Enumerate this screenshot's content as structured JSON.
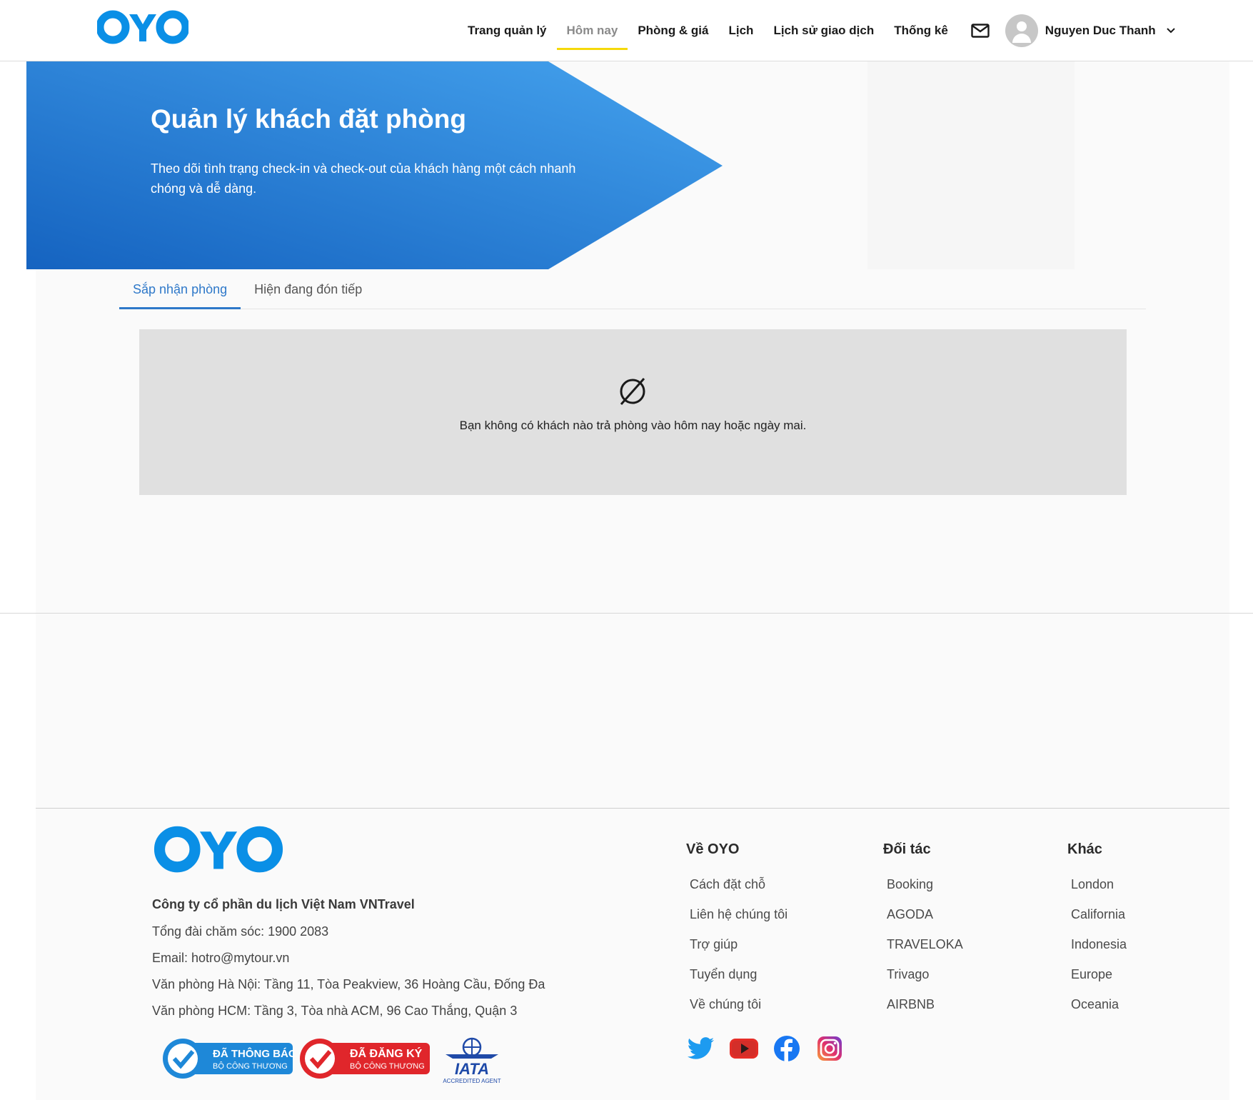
{
  "header": {
    "logo_text": "OYO",
    "nav": [
      {
        "label": "Trang quản lý",
        "active": false
      },
      {
        "label": "Hôm nay",
        "active": true
      },
      {
        "label": "Phòng & giá",
        "active": false
      },
      {
        "label": "Lịch",
        "active": false
      },
      {
        "label": "Lịch sử giao dịch",
        "active": false
      },
      {
        "label": "Thống kê",
        "active": false
      }
    ],
    "mail_icon": "mail-icon",
    "user": {
      "name": "Nguyen Duc Thanh",
      "avatar_icon": "user-avatar-icon",
      "dropdown_icon": "chevron-down-icon"
    }
  },
  "banner": {
    "title": "Quản lý khách đặt phòng",
    "description": "Theo dõi tình trạng check-in và check-out của khách hàng một cách nhanh chóng và dễ dàng."
  },
  "tabs": [
    {
      "label": "Sắp nhận phòng",
      "active": true
    },
    {
      "label": "Hiện đang đón tiếp",
      "active": false
    }
  ],
  "empty_state": {
    "icon": "empty-set-icon",
    "message": "Bạn không có khách nào trả phòng vào hôm nay hoặc ngày mai."
  },
  "footer": {
    "logo_text": "OYO",
    "company": "Công ty cổ phần du lịch Việt Nam VNTravel",
    "hotline": "Tổng đài chăm sóc: 1900 2083",
    "email": "Email: hotro@mytour.vn",
    "office_hn": "Văn phòng Hà Nội: Tầng 11, Tòa Peakview, 36 Hoàng Cầu, Đống Đa",
    "office_hcm": "Văn phòng HCM: Tầng 3, Tòa nhà ACM, 96 Cao Thắng, Quận 3",
    "columns": [
      {
        "title": "Về OYO",
        "links": [
          "Cách đặt chỗ",
          "Liên hệ chúng tôi",
          "Trợ giúp",
          "Tuyển dụng",
          "Về chúng tôi"
        ]
      },
      {
        "title": "Đối tác",
        "links": [
          "Booking",
          "AGODA",
          "TRAVELOKA",
          "Trivago",
          "AIRBNB"
        ]
      },
      {
        "title": "Khác",
        "links": [
          "London",
          "California",
          "Indonesia",
          "Europe",
          "Oceania"
        ]
      }
    ],
    "badges": [
      {
        "line1": "ĐÃ THÔNG BÁO",
        "line2": "BỘ CÔNG THƯƠNG",
        "color": "#1e88d8"
      },
      {
        "line1": "ĐÃ ĐĂNG KÝ",
        "line2": "BỘ CÔNG THƯƠNG",
        "color": "#e0262b"
      },
      {
        "line1": "IATA",
        "line2": "ACCREDITED AGENT",
        "color": "#1f4aa8"
      }
    ],
    "social": [
      "twitter-icon",
      "youtube-icon",
      "facebook-icon",
      "instagram-icon"
    ]
  },
  "colors": {
    "brand": "#0a8fe6",
    "banner_start": "#1a6cc4",
    "banner_end": "#3a9ae8",
    "tab_active": "#2e78c9",
    "nav_underline": "#f5d90a"
  }
}
